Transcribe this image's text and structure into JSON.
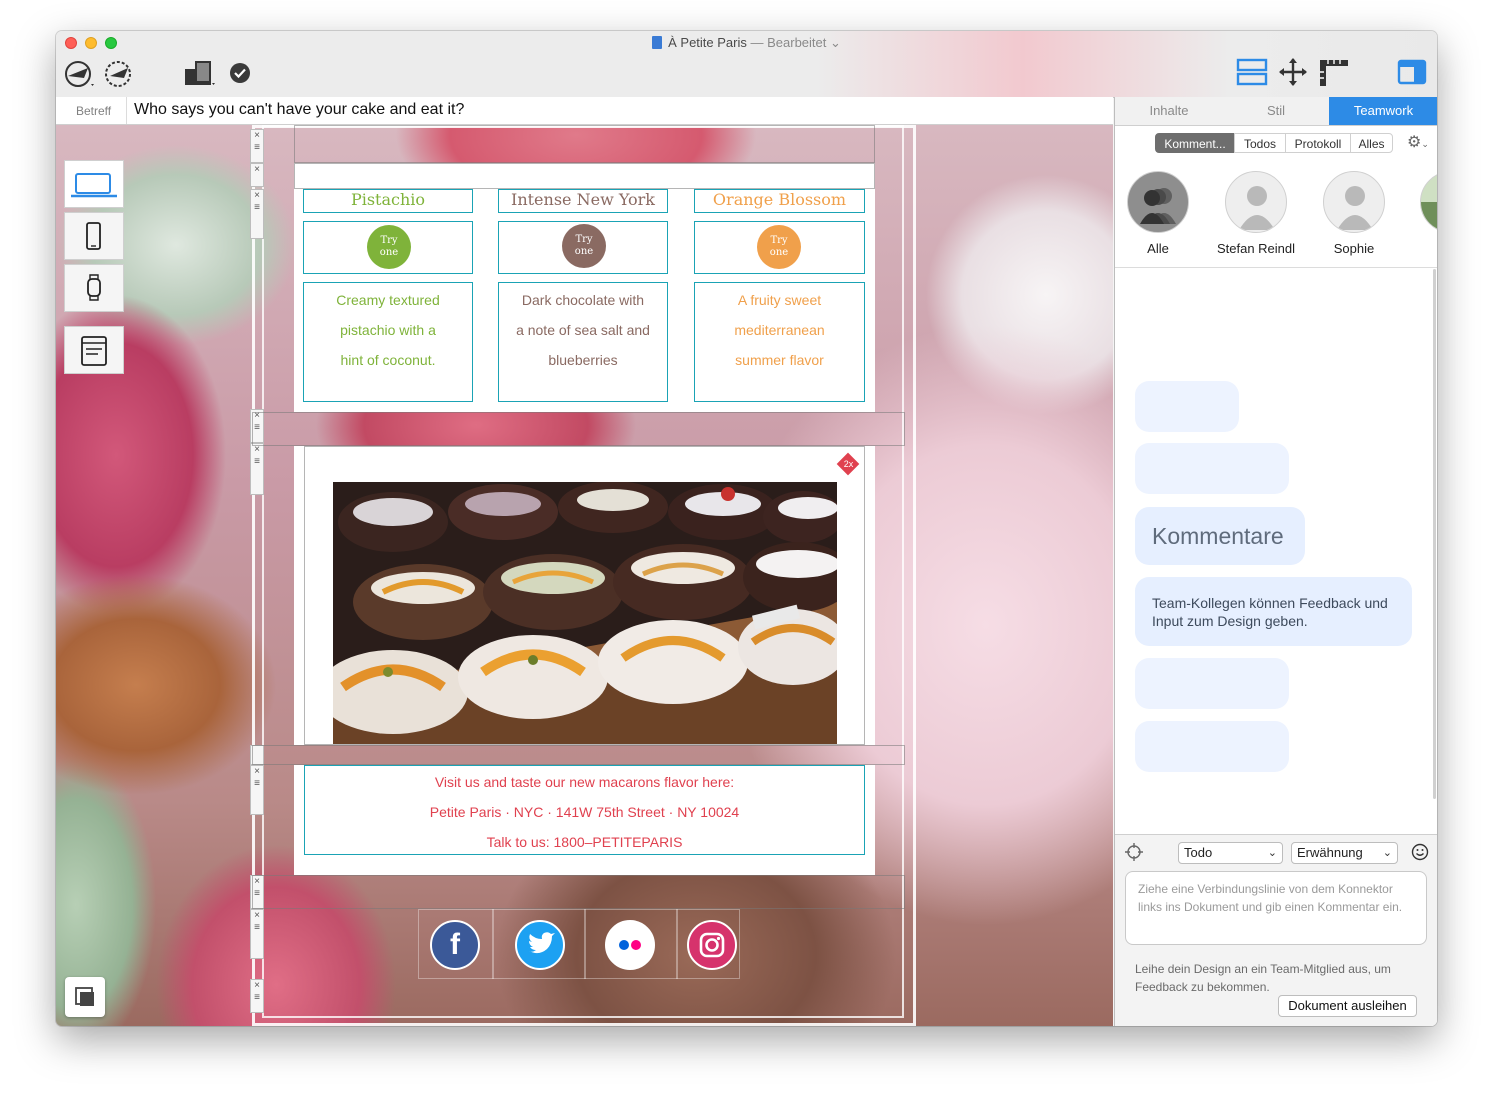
{
  "window": {
    "title": "À Petite Paris",
    "title_status": "— Bearbeitet ⌄"
  },
  "toolbar": {
    "icons": [
      "send-icon",
      "test-send-icon",
      "devices-icon",
      "check-icon",
      "layout-icon",
      "move-icon",
      "ruler-icon",
      "panel-toggle-icon"
    ]
  },
  "subject": {
    "label": "Betreff",
    "value": "Who says you can't have your cake and eat it?"
  },
  "device_bar": {
    "items": [
      "desktop",
      "phone",
      "watch",
      "source"
    ]
  },
  "email": {
    "flavors": [
      {
        "name": "Pistachio",
        "button": [
          "Try",
          "one"
        ],
        "description": [
          "Creamy textured",
          "pistachio with a",
          "hint of coconut."
        ],
        "color": "#7fb33a"
      },
      {
        "name": "Intense New York",
        "button": [
          "Try",
          "one"
        ],
        "description": [
          "Dark chocolate with",
          "a note of sea salt and",
          "blueberries"
        ],
        "color": "#8a6a62"
      },
      {
        "name": "Orange Blossom",
        "button": [
          "Try",
          "one"
        ],
        "description": [
          "A fruity sweet",
          "mediterranean",
          "summer flavor"
        ],
        "color": "#f0a04b"
      }
    ],
    "retina_badge": "2x",
    "footer_lines": [
      "Visit us and taste our new macarons flavor here:",
      "Petite Paris · NYC · 141W 75th Street · NY 10024",
      "Talk to us: 1800–PETITEPARIS"
    ],
    "footer_color": "#e0414f",
    "social": [
      {
        "name": "facebook",
        "glyph": "f",
        "color": "#3b5998"
      },
      {
        "name": "twitter",
        "glyph": "t",
        "color": "#1da1f2"
      },
      {
        "name": "flickr",
        "glyph": "",
        "color": "#ffffff"
      },
      {
        "name": "instagram",
        "glyph": "◎",
        "color": "#d6336c"
      }
    ]
  },
  "panel": {
    "tabs": [
      "Inhalte",
      "Stil",
      "Teamwork"
    ],
    "active_tab": "Teamwork",
    "filters": [
      "Komment...",
      "Todos",
      "Protokoll",
      "Alles"
    ],
    "active_filter": "Komment...",
    "members": [
      "Alle",
      "Stefan Reindl",
      "Sophie"
    ],
    "placeholder_title": "Kommentare",
    "placeholder_text": [
      "Team-Kollegen können Feedback und",
      "Input zum Design geben."
    ],
    "type_select": "Todo",
    "mention_select": "Erwähnung",
    "comment_placeholder": "Ziehe eine Verbindungslinie von dem Konnektor links ins Dokument und gib einen Kommentar ein.",
    "lend_hint": "Leihe dein Design an ein Team-Mitglied aus, um Feedback zu bekommen.",
    "lend_button": "Dokument ausleihen"
  }
}
